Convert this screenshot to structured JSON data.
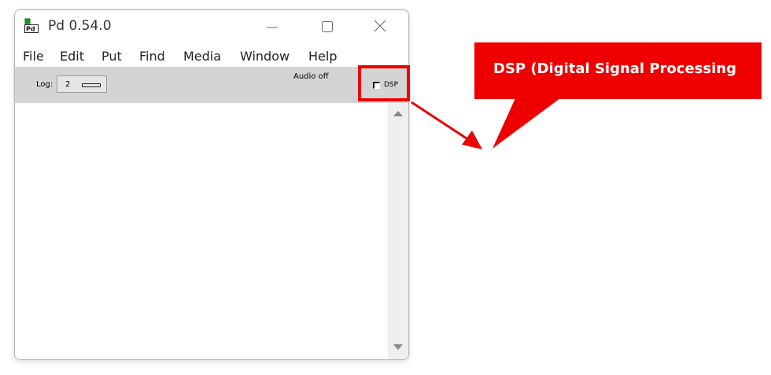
{
  "window": {
    "title": "Pd 0.54.0",
    "app_icon": "pd-app-icon",
    "controls": [
      "minimize-icon",
      "maximize-icon",
      "close-icon"
    ]
  },
  "menubar": {
    "items": [
      "File",
      "Edit",
      "Put",
      "Find",
      "Media",
      "Window",
      "Help"
    ]
  },
  "toolbar": {
    "log_label": "Log:",
    "log_value": "2",
    "audio_status": "Audio off",
    "dsp_label": "DSP",
    "dsp_checked": false
  },
  "annotation": {
    "callout_text": "DSP (Digital Signal Processing",
    "color": "#ee0000"
  }
}
